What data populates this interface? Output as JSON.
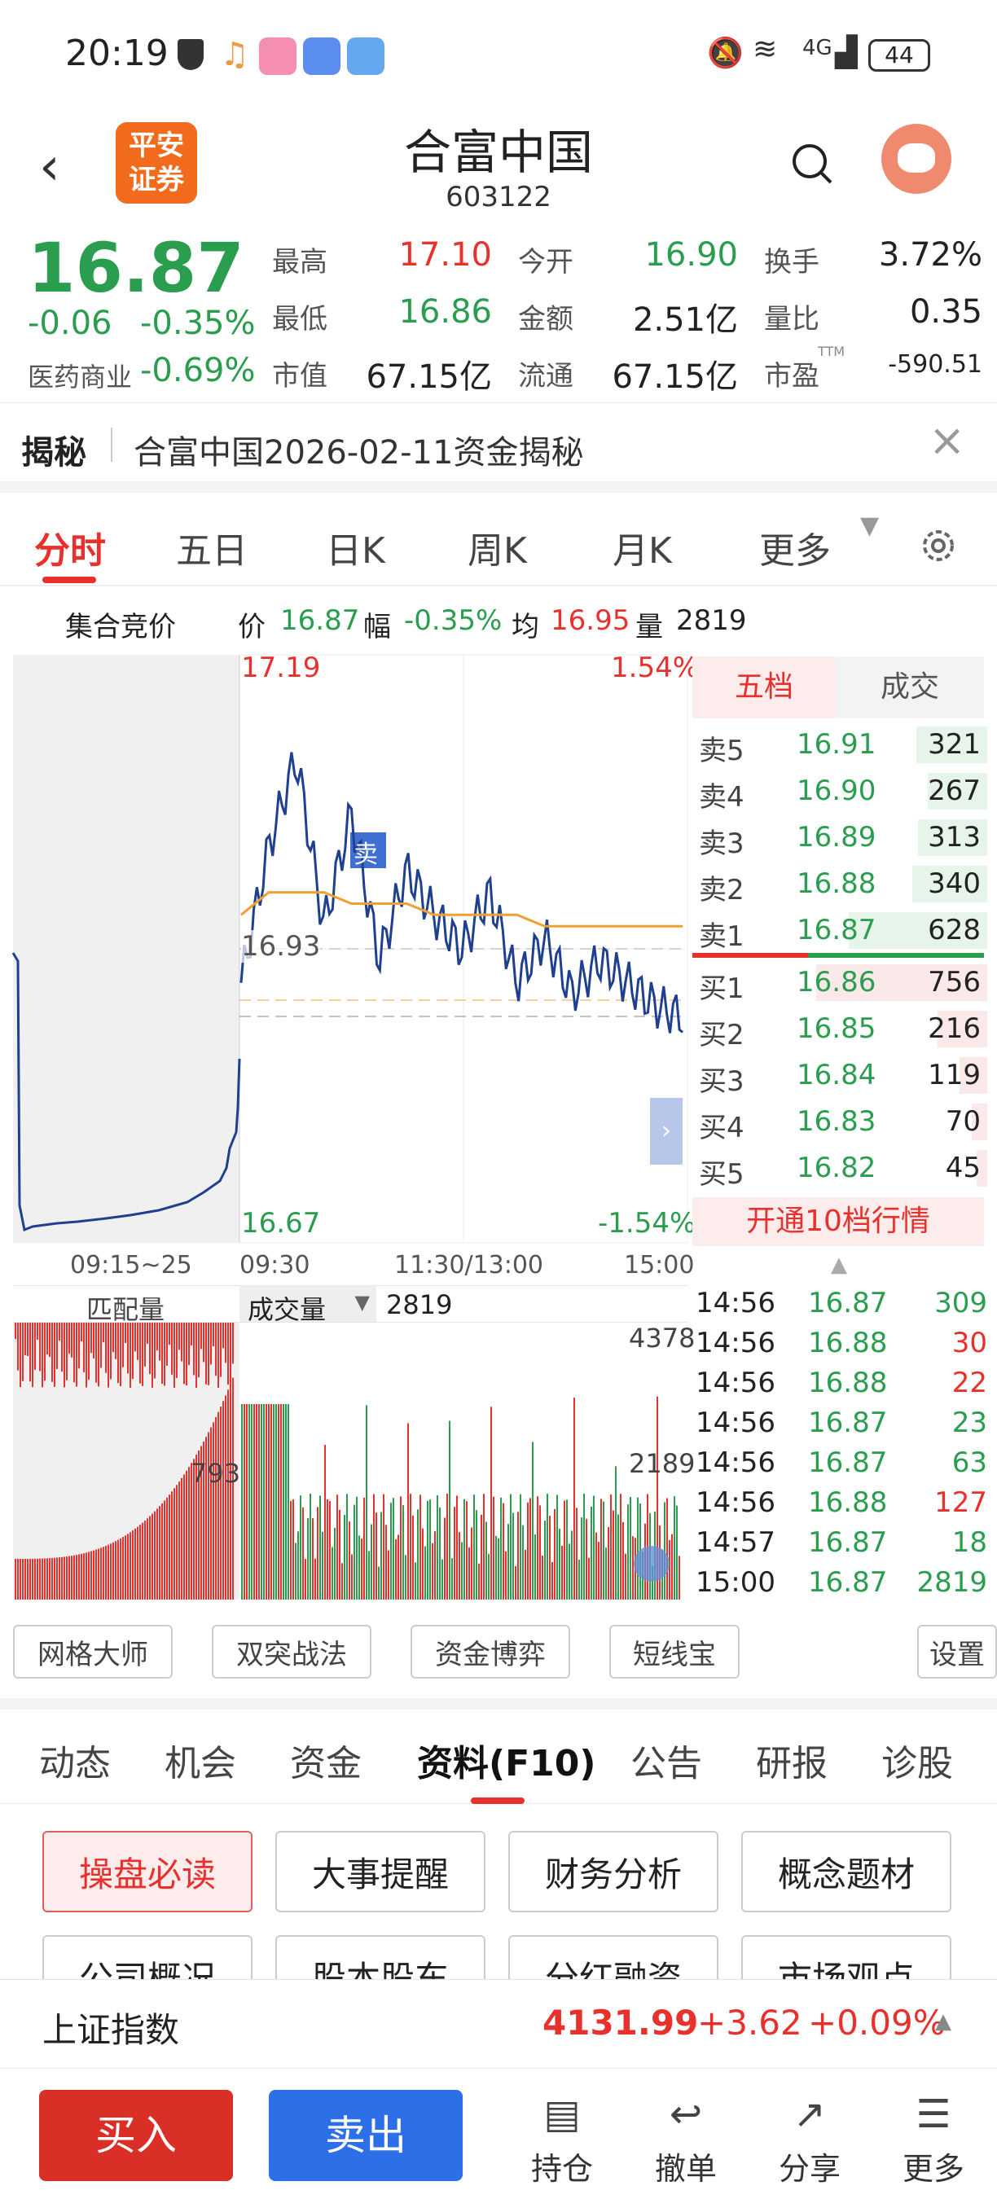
{
  "status": {
    "time": "20:19",
    "battery": "44",
    "network": "4G"
  },
  "header": {
    "logo_line1": "平安",
    "logo_line2": "证券",
    "title": "合富中国",
    "code": "603122"
  },
  "quote": {
    "price": "16.87",
    "change": "-0.06",
    "change_pct": "-0.35%",
    "sector_name": "医药商业",
    "sector_pct": "-0.69%",
    "fields": [
      {
        "label": "最高",
        "value": "17.10",
        "color": "#e8302c"
      },
      {
        "label": "今开",
        "value": "16.90",
        "color": "#2a9d4f"
      },
      {
        "label": "换手",
        "value": "3.72%",
        "color": "#222222"
      },
      {
        "label": "最低",
        "value": "16.86",
        "color": "#2a9d4f"
      },
      {
        "label": "金额",
        "value": "2.51亿",
        "color": "#222222"
      },
      {
        "label": "量比",
        "value": "0.35",
        "color": "#222222"
      },
      {
        "label": "市值",
        "value": "67.15亿",
        "color": "#222222"
      },
      {
        "label": "流通",
        "value": "67.15亿",
        "color": "#222222"
      },
      {
        "label": "市盈",
        "value": "-590.51",
        "color": "#222222",
        "sup": "TTM"
      }
    ]
  },
  "reveal": {
    "tag": "揭秘",
    "text": "合富中国2026-02-11资金揭秘"
  },
  "chart_tabs": [
    "分时",
    "五日",
    "日K",
    "周K",
    "月K",
    "更多"
  ],
  "price_bar": {
    "auction_label": "集合竞价",
    "price_label": "价",
    "price": "16.87",
    "range_label": "幅",
    "range": "-0.35%",
    "avg_label": "均",
    "avg": "16.95",
    "vol_label": "量",
    "vol": "2819"
  },
  "chart": {
    "high_label": "17.19",
    "high_pct": "1.54%",
    "low_label": "16.67",
    "low_pct": "-1.54%",
    "ref_label": "16.93",
    "sell_marker": "卖",
    "time_labels": [
      "09:15~25",
      "09:30",
      "11:30/13:00",
      "15:00"
    ],
    "vol_header_left": "匹配量",
    "vol_header_sel": "成交量",
    "vol_header_value": "2819",
    "vol_max": "4378",
    "vol_mid": "2189",
    "match_label": "793"
  },
  "chart_data": {
    "type": "line",
    "title": "",
    "series": [
      {
        "values": [
          16.9,
          17.02,
          17.1,
          16.95,
          17.05,
          16.92,
          17.0,
          16.96,
          16.93,
          16.98,
          16.9,
          16.94,
          16.89,
          16.92,
          16.9,
          16.88,
          16.87
        ]
      },
      {
        "values": [
          16.96,
          16.98,
          16.98,
          16.98,
          16.97,
          16.97,
          16.97,
          16.96,
          16.96,
          16.96,
          16.96,
          16.95,
          16.95,
          16.95,
          16.95,
          16.95,
          16.95
        ]
      }
    ],
    "ylim": [
      16.67,
      17.19
    ]
  },
  "orderbook": {
    "tabs": [
      "五档",
      "成交"
    ],
    "asks": [
      {
        "label": "卖5",
        "price": "16.91",
        "vol": "321",
        "bar": 0.51
      },
      {
        "label": "卖4",
        "price": "16.90",
        "vol": "267",
        "bar": 0.43
      },
      {
        "label": "卖3",
        "price": "16.89",
        "vol": "313",
        "bar": 0.5
      },
      {
        "label": "卖2",
        "price": "16.88",
        "vol": "340",
        "bar": 0.54
      },
      {
        "label": "卖1",
        "price": "16.87",
        "vol": "628",
        "bar": 1.0
      }
    ],
    "bids": [
      {
        "label": "买1",
        "price": "16.86",
        "vol": "756",
        "bar": 1.0
      },
      {
        "label": "买2",
        "price": "16.85",
        "vol": "216",
        "bar": 0.29
      },
      {
        "label": "买3",
        "price": "16.84",
        "vol": "119",
        "bar": 0.16
      },
      {
        "label": "买4",
        "price": "16.83",
        "vol": "70",
        "bar": 0.09
      },
      {
        "label": "买5",
        "price": "16.82",
        "vol": "45",
        "bar": 0.06
      }
    ],
    "open_level10": "开通10档行情"
  },
  "ticks": [
    {
      "time": "14:56",
      "price": "16.87",
      "vol": "309",
      "color": "#2a9d4f"
    },
    {
      "time": "14:56",
      "price": "16.88",
      "vol": "30",
      "color": "#e8302c"
    },
    {
      "time": "14:56",
      "price": "16.88",
      "vol": "22",
      "color": "#e8302c"
    },
    {
      "time": "14:56",
      "price": "16.87",
      "vol": "23",
      "color": "#2a9d4f"
    },
    {
      "time": "14:56",
      "price": "16.87",
      "vol": "63",
      "color": "#2a9d4f"
    },
    {
      "time": "14:56",
      "price": "16.88",
      "vol": "127",
      "color": "#e8302c"
    },
    {
      "time": "14:57",
      "price": "16.87",
      "vol": "18",
      "color": "#2a9d4f"
    },
    {
      "time": "15:00",
      "price": "16.87",
      "vol": "2819",
      "color": "#2a9d4f"
    }
  ],
  "tools": [
    "网格大师",
    "双突战法",
    "资金博弈",
    "短线宝",
    "设置"
  ],
  "section_tabs": [
    "动态",
    "机会",
    "资金",
    "资料(F10)",
    "公告",
    "研报",
    "诊股"
  ],
  "f10_buttons": [
    "操盘必读",
    "大事提醒",
    "财务分析",
    "概念题材",
    "公司概况",
    "股本股东",
    "分红融资",
    "市场观点"
  ],
  "index_bar": {
    "name": "上证指数",
    "value": "4131.99",
    "change": "+3.62",
    "pct": "+0.09%"
  },
  "bottom": {
    "buy": "买入",
    "sell": "卖出",
    "actions": [
      "持仓",
      "撤单",
      "分享",
      "更多"
    ]
  },
  "colors": {
    "red": "#e8302c",
    "green": "#2a9d4f",
    "blue": "#2d6fe6",
    "price_line": "#1f3f8f",
    "avg_line": "#f0a030"
  }
}
